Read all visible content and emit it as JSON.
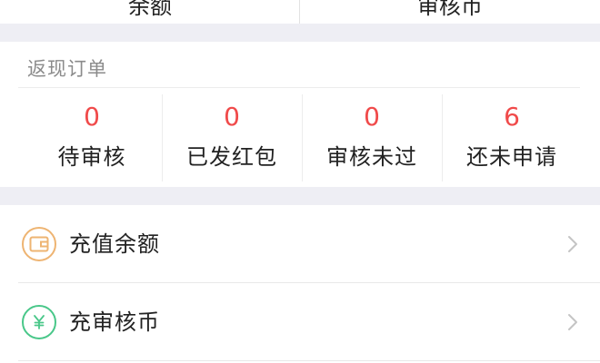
{
  "balance_bar": {
    "left_label": "余额",
    "right_label": "审核币"
  },
  "rebate_orders": {
    "title": "返现订单",
    "stats": [
      {
        "count": "0",
        "label": "待审核"
      },
      {
        "count": "0",
        "label": "已发红包"
      },
      {
        "count": "0",
        "label": "审核未过"
      },
      {
        "count": "6",
        "label": "还未申请"
      }
    ]
  },
  "menu": {
    "items": [
      {
        "label": "充值余额",
        "icon": "wallet-icon"
      },
      {
        "label": "充审核币",
        "icon": "yen-coin-icon"
      }
    ]
  },
  "colors": {
    "accent_red": "#f04a4a",
    "icon_orange": "#eeb472",
    "icon_green": "#49c789",
    "section_gap": "#eeeef4"
  }
}
